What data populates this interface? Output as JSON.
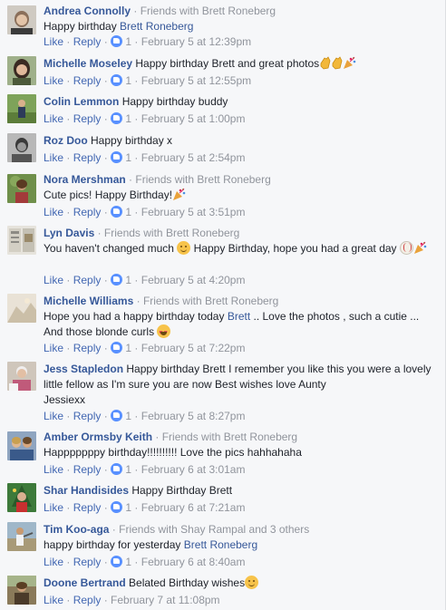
{
  "labels": {
    "like": "Like",
    "reply": "Reply",
    "sep": " · ",
    "like_count": "1"
  },
  "comments": [
    {
      "author": "Andrea Connolly",
      "friends": "Friends with Brett Roneberg",
      "text": "Happy birthday ",
      "mention": "Brett Roneberg",
      "time": "February 5 at 12:39pm"
    },
    {
      "author": "Michelle Moseley",
      "text": "Happy birthday Brett and great photos",
      "time": "February 5 at 12:55pm",
      "emoji": [
        "clapping-hands",
        "clapping-hands",
        "party-popper"
      ]
    },
    {
      "author": "Colin Lemmon",
      "text": "Happy birthday buddy",
      "time": "February 5 at 1:00pm"
    },
    {
      "author": "Roz Doo",
      "text": "Happy birthday x",
      "time": "February 5 at 2:54pm"
    },
    {
      "author": "Nora Mershman",
      "friends": "Friends with Brett Roneberg",
      "text": "Cute pics! Happy Birthday!",
      "time": "February 5 at 3:51pm",
      "emoji": [
        "party-popper"
      ]
    },
    {
      "author": "Lyn Davis",
      "friends": "Friends with Brett Roneberg",
      "text_a": "You haven't changed much ",
      "text_b": " Happy Birthday, hope you had a great day ",
      "time": "February 5 at 4:20pm",
      "emoji": [
        "smiling-face",
        "baseball",
        "party-popper"
      ]
    },
    {
      "author": "Michelle Williams",
      "friends": "Friends with Brett Roneberg",
      "text_a": "Hope you had a happy birthday today ",
      "mention": "Brett",
      "text_b": " .. Love the photos , such a cutie ...",
      "text_c": "And those blonde curls ",
      "time": "February 5 at 7:22pm",
      "emoji": [
        "heart-eyes-face"
      ]
    },
    {
      "author": "Jess Stapledon",
      "text_a": "Happy birthday Brett I remember you like this you were a lovely",
      "text_b": "little fellow as I'm sure you are now Best wishes love Aunty",
      "text_c": "Jessiexx",
      "time": "February 5 at 8:27pm"
    },
    {
      "author": "Amber Ormsby Keith",
      "friends": "Friends with Brett Roneberg",
      "text": "Happpppppy birthday!!!!!!!!!! Love the pics hahhahaha",
      "time": "February 6 at 3:01am"
    },
    {
      "author": "Shar Handisides",
      "text": "Happy Birthday Brett",
      "time": "February 6 at 7:21am"
    },
    {
      "author": "Tim Koo-aga",
      "friends": "Friends with Shay Rampal and 3 others",
      "text": "happy birthday for yesterday ",
      "mention": "Brett Roneberg",
      "time": "February 6 at 8:40am"
    },
    {
      "author": "Doone Bertrand",
      "text": "Belated Birthday wishes",
      "time": "February 7 at 11:08pm",
      "emoji": [
        "smiling-face"
      ]
    }
  ],
  "colors": {
    "link": "#365899",
    "action_link": "#4267b2",
    "meta": "#90949c",
    "like_blue": "#5890ff",
    "background": "#f6f7f9"
  }
}
